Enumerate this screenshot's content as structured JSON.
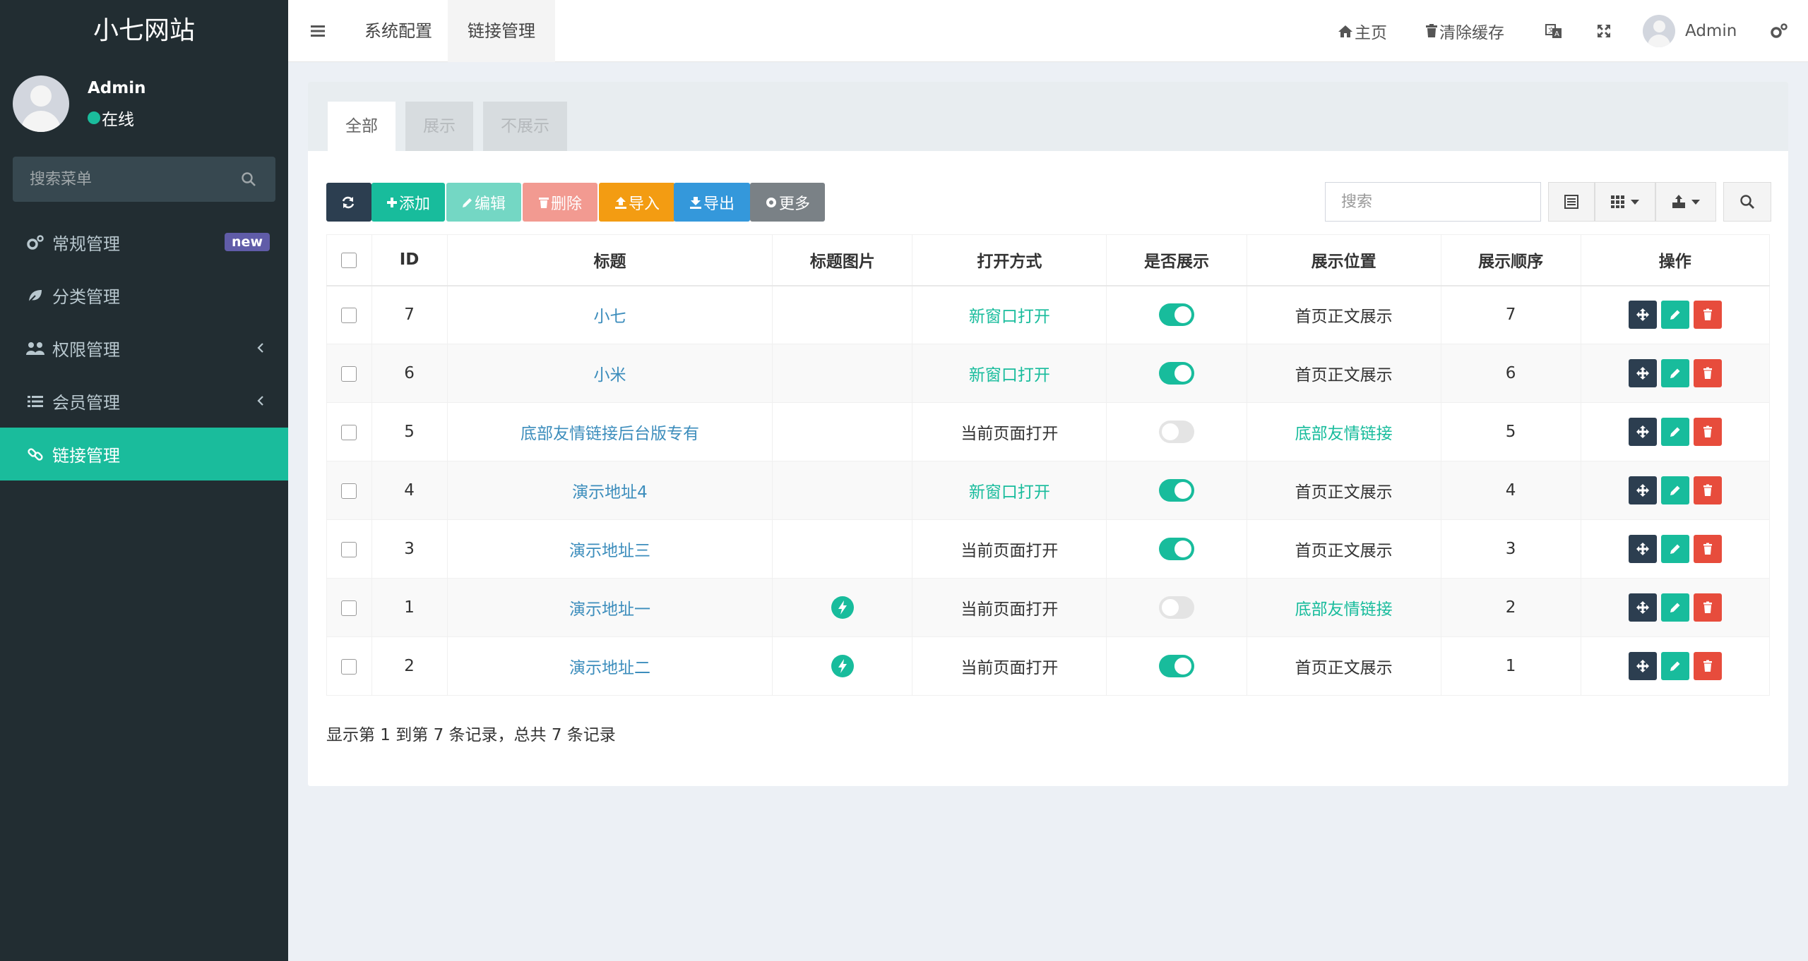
{
  "app": {
    "logo": "小七网站"
  },
  "user": {
    "name": "Admin",
    "status": "在线"
  },
  "menu_search": {
    "placeholder": "搜索菜单"
  },
  "sidebar": {
    "items": [
      {
        "label": "常规管理",
        "icon": "cogs-icon",
        "badge": "new"
      },
      {
        "label": "分类管理",
        "icon": "leaf-icon"
      },
      {
        "label": "权限管理",
        "icon": "users-icon"
      },
      {
        "label": "会员管理",
        "icon": "list-icon"
      },
      {
        "label": "链接管理",
        "icon": "link-icon",
        "active": true
      }
    ]
  },
  "header": {
    "tabs": [
      {
        "label": "系统配置"
      },
      {
        "label": "链接管理",
        "active": true
      }
    ],
    "home": "主页",
    "clear_cache": "清除缓存",
    "admin": "Admin"
  },
  "panel": {
    "tabs": [
      {
        "label": "全部",
        "active": true
      },
      {
        "label": "展示"
      },
      {
        "label": "不展示"
      }
    ]
  },
  "toolbar": {
    "add": "添加",
    "edit": "编辑",
    "delete": "删除",
    "import": "导入",
    "export": "导出",
    "more": "更多",
    "search_placeholder": "搜索"
  },
  "colors": {
    "accent": "#1abc9c",
    "sidebar_bg": "#222d32",
    "danger": "#e74c3c",
    "dark": "#2c3e50",
    "warning": "#f39c12",
    "info": "#3498db"
  },
  "table": {
    "headers": [
      "ID",
      "标题",
      "标题图片",
      "打开方式",
      "是否展示",
      "展示位置",
      "展示顺序",
      "操作"
    ],
    "rows": [
      {
        "id": "7",
        "title": "小七",
        "image": false,
        "open": "新窗口打开",
        "open_link": true,
        "show": true,
        "position": "首页正文展示",
        "position_link": false,
        "order": "7"
      },
      {
        "id": "6",
        "title": "小米",
        "image": false,
        "open": "新窗口打开",
        "open_link": true,
        "show": true,
        "position": "首页正文展示",
        "position_link": false,
        "order": "6"
      },
      {
        "id": "5",
        "title": "底部友情链接后台版专有",
        "image": false,
        "open": "当前页面打开",
        "open_link": false,
        "show": false,
        "position": "底部友情链接",
        "position_link": true,
        "order": "5"
      },
      {
        "id": "4",
        "title": "演示地址4",
        "image": false,
        "open": "新窗口打开",
        "open_link": true,
        "show": true,
        "position": "首页正文展示",
        "position_link": false,
        "order": "4"
      },
      {
        "id": "3",
        "title": "演示地址三",
        "image": false,
        "open": "当前页面打开",
        "open_link": false,
        "show": true,
        "position": "首页正文展示",
        "position_link": false,
        "order": "3"
      },
      {
        "id": "1",
        "title": "演示地址一",
        "image": true,
        "open": "当前页面打开",
        "open_link": false,
        "show": false,
        "position": "底部友情链接",
        "position_link": true,
        "order": "2"
      },
      {
        "id": "2",
        "title": "演示地址二",
        "image": true,
        "open": "当前页面打开",
        "open_link": false,
        "show": true,
        "position": "首页正文展示",
        "position_link": false,
        "order": "1"
      }
    ]
  },
  "footer": {
    "info": "显示第 1 到第 7 条记录，总共 7 条记录"
  }
}
